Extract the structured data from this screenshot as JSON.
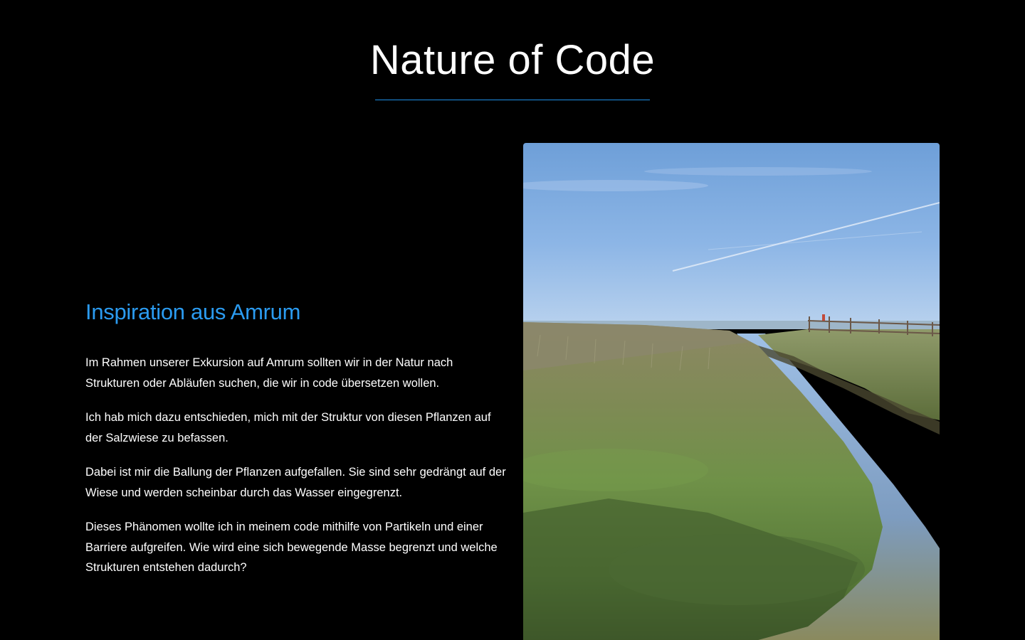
{
  "header": {
    "title": "Nature of Code",
    "accent_color": "#1e90e8"
  },
  "section": {
    "heading": "Inspiration aus Amrum",
    "heading_color": "#2b9bf0",
    "paragraphs": [
      "Im Rahmen unserer Exkursion auf Amrum sollten wir in der Natur nach Strukturen oder Abläufen suchen, die wir in code übersetzen wollen.",
      "Ich hab mich dazu entschieden, mich mit der Struktur von diesen Pflanzen auf der Salzwiese zu befassen.",
      "Dabei ist mir die Ballung der Pflanzen aufgefallen. Sie sind sehr gedrängt auf der Wiese und werden scheinbar durch das Wasser eingegrenzt.",
      "Dieses Phänomen wollte ich in meinem code mithilfe von Partikeln und einer Barriere aufgreifen. Wie wird eine sich bewegende Masse begrenzt und welche Strukturen entstehen dadurch?"
    ]
  },
  "photo": {
    "subject": "salt-marsh-creek-photo"
  }
}
